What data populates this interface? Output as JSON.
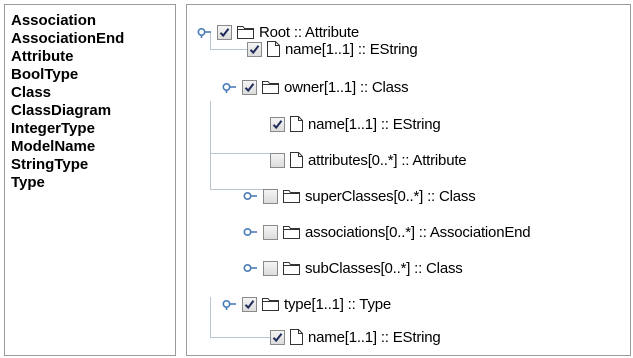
{
  "type_list": [
    "Association",
    "AssociationEnd",
    "Attribute",
    "BoolType",
    "Class",
    "ClassDiagram",
    "IntegerType",
    "ModelName",
    "StringType",
    "Type"
  ],
  "tree": {
    "root": {
      "label": "Root :: Attribute",
      "checked": true,
      "expanded": true,
      "icon": "folder-icon"
    },
    "root_name": {
      "label": "name[1..1] :: EString",
      "checked": true,
      "icon": "file-icon"
    },
    "owner": {
      "label": "owner[1..1] :: Class",
      "checked": true,
      "expanded": true,
      "icon": "folder-icon"
    },
    "owner_name": {
      "label": "name[1..1] :: EString",
      "checked": true,
      "icon": "file-icon"
    },
    "owner_attributes": {
      "label": "attributes[0..*] :: Attribute",
      "checked": false,
      "icon": "file-icon"
    },
    "owner_superclasses": {
      "label": "superClasses[0..*] :: Class",
      "checked": false,
      "expanded": false,
      "icon": "folder-icon"
    },
    "owner_associations": {
      "label": "associations[0..*] :: AssociationEnd",
      "checked": false,
      "expanded": false,
      "icon": "folder-icon"
    },
    "owner_subclasses": {
      "label": "subClasses[0..*] :: Class",
      "checked": false,
      "expanded": false,
      "icon": "folder-icon"
    },
    "type": {
      "label": "type[1..1] :: Type",
      "checked": true,
      "expanded": true,
      "icon": "folder-icon"
    },
    "type_name": {
      "label": "name[1..1] :: EString",
      "checked": true,
      "icon": "file-icon"
    }
  },
  "colors": {
    "connector": "#b9c6d2",
    "toggle": "#4a7db8",
    "check": "#1e2a5a"
  }
}
